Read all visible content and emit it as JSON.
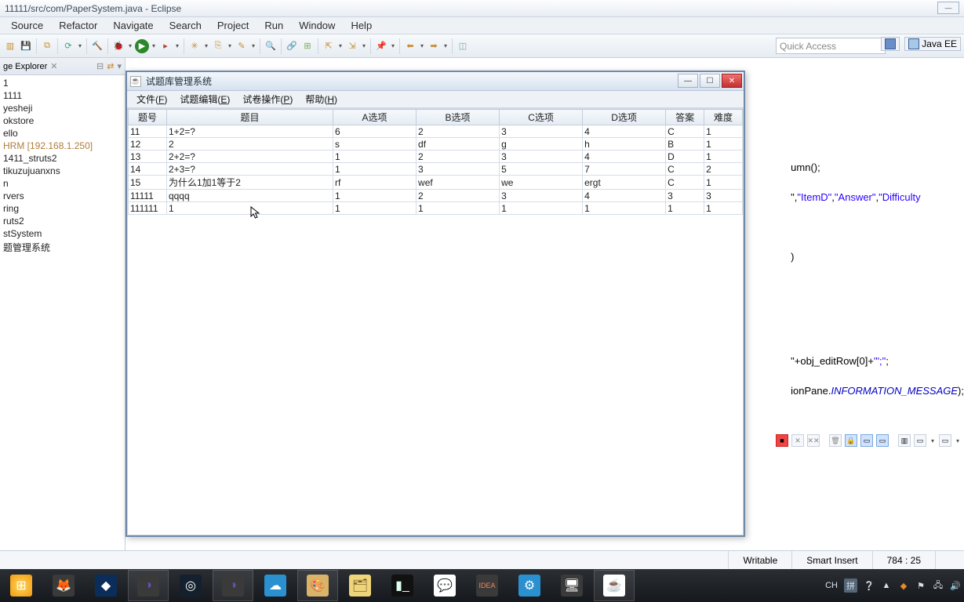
{
  "eclipse": {
    "title": "11111/src/com/PaperSystem.java - Eclipse",
    "menus": [
      "Source",
      "Refactor",
      "Navigate",
      "Search",
      "Project",
      "Run",
      "Window",
      "Help"
    ],
    "quick_access_placeholder": "Quick Access",
    "perspective": "Java EE",
    "package_explorer_title": "ge Explorer",
    "projects": [
      {
        "label": "1"
      },
      {
        "label": "1111"
      },
      {
        "label": "yesheji"
      },
      {
        "label": "okstore"
      },
      {
        "label": "ello"
      },
      {
        "label": "HRM   [192.168.1.250]",
        "hl": true
      },
      {
        "label": "1411_struts2"
      },
      {
        "label": "tikuzujuanxns"
      },
      {
        "label": "n"
      },
      {
        "label": "rvers"
      },
      {
        "label": "ring"
      },
      {
        "label": "ruts2"
      },
      {
        "label": "stSystem"
      },
      {
        "label": "题管理系统"
      }
    ],
    "code_lines": [
      "umn();",
      "",
      "\",\"ItemD\",\"Answer\",\"Difficulty",
      "",
      "",
      "",
      ")",
      "",
      "",
      "",
      "",
      "",
      "",
      "\"+obj_editRow[0]+\"';\";",
      "",
      "ionPane.INFORMATION_MESSAGE);"
    ]
  },
  "swing": {
    "title": "试题库管理系统",
    "menus": [
      {
        "pre": "文件(",
        "u": "F",
        "post": ")"
      },
      {
        "pre": "试题编辑(",
        "u": "E",
        "post": ")"
      },
      {
        "pre": "试卷操作(",
        "u": "P",
        "post": ")"
      },
      {
        "pre": "帮助(",
        "u": "H",
        "post": ")"
      }
    ],
    "columns": [
      "题号",
      "题目",
      "A选项",
      "B选项",
      "C选项",
      "D选项",
      "答案",
      "难度"
    ],
    "rows": [
      [
        "11",
        "1+2=?",
        "6",
        "2",
        "3",
        "4",
        "C",
        "1"
      ],
      [
        "12",
        "2",
        "s",
        "df",
        "g",
        "h",
        "B",
        "1"
      ],
      [
        "13",
        "2+2=?",
        "1",
        "2",
        "3",
        "4",
        "D",
        "1"
      ],
      [
        "14",
        "2+3=?",
        "1",
        "3",
        "5",
        "7",
        "C",
        "2"
      ],
      [
        "15",
        "为什么1加1等于2",
        "rf",
        "wef",
        "we",
        "ergt",
        "C",
        "1"
      ],
      [
        "11111",
        "qqqq",
        "1",
        "2",
        "3",
        "4",
        "3",
        "3"
      ],
      [
        "111111",
        "1",
        "1",
        "1",
        "1",
        "1",
        "1",
        "1"
      ]
    ]
  },
  "status": {
    "writable": "Writable",
    "insert": "Smart Insert",
    "position": "784 : 25"
  },
  "tray": {
    "ime": "CH",
    "kbd": "拼"
  }
}
